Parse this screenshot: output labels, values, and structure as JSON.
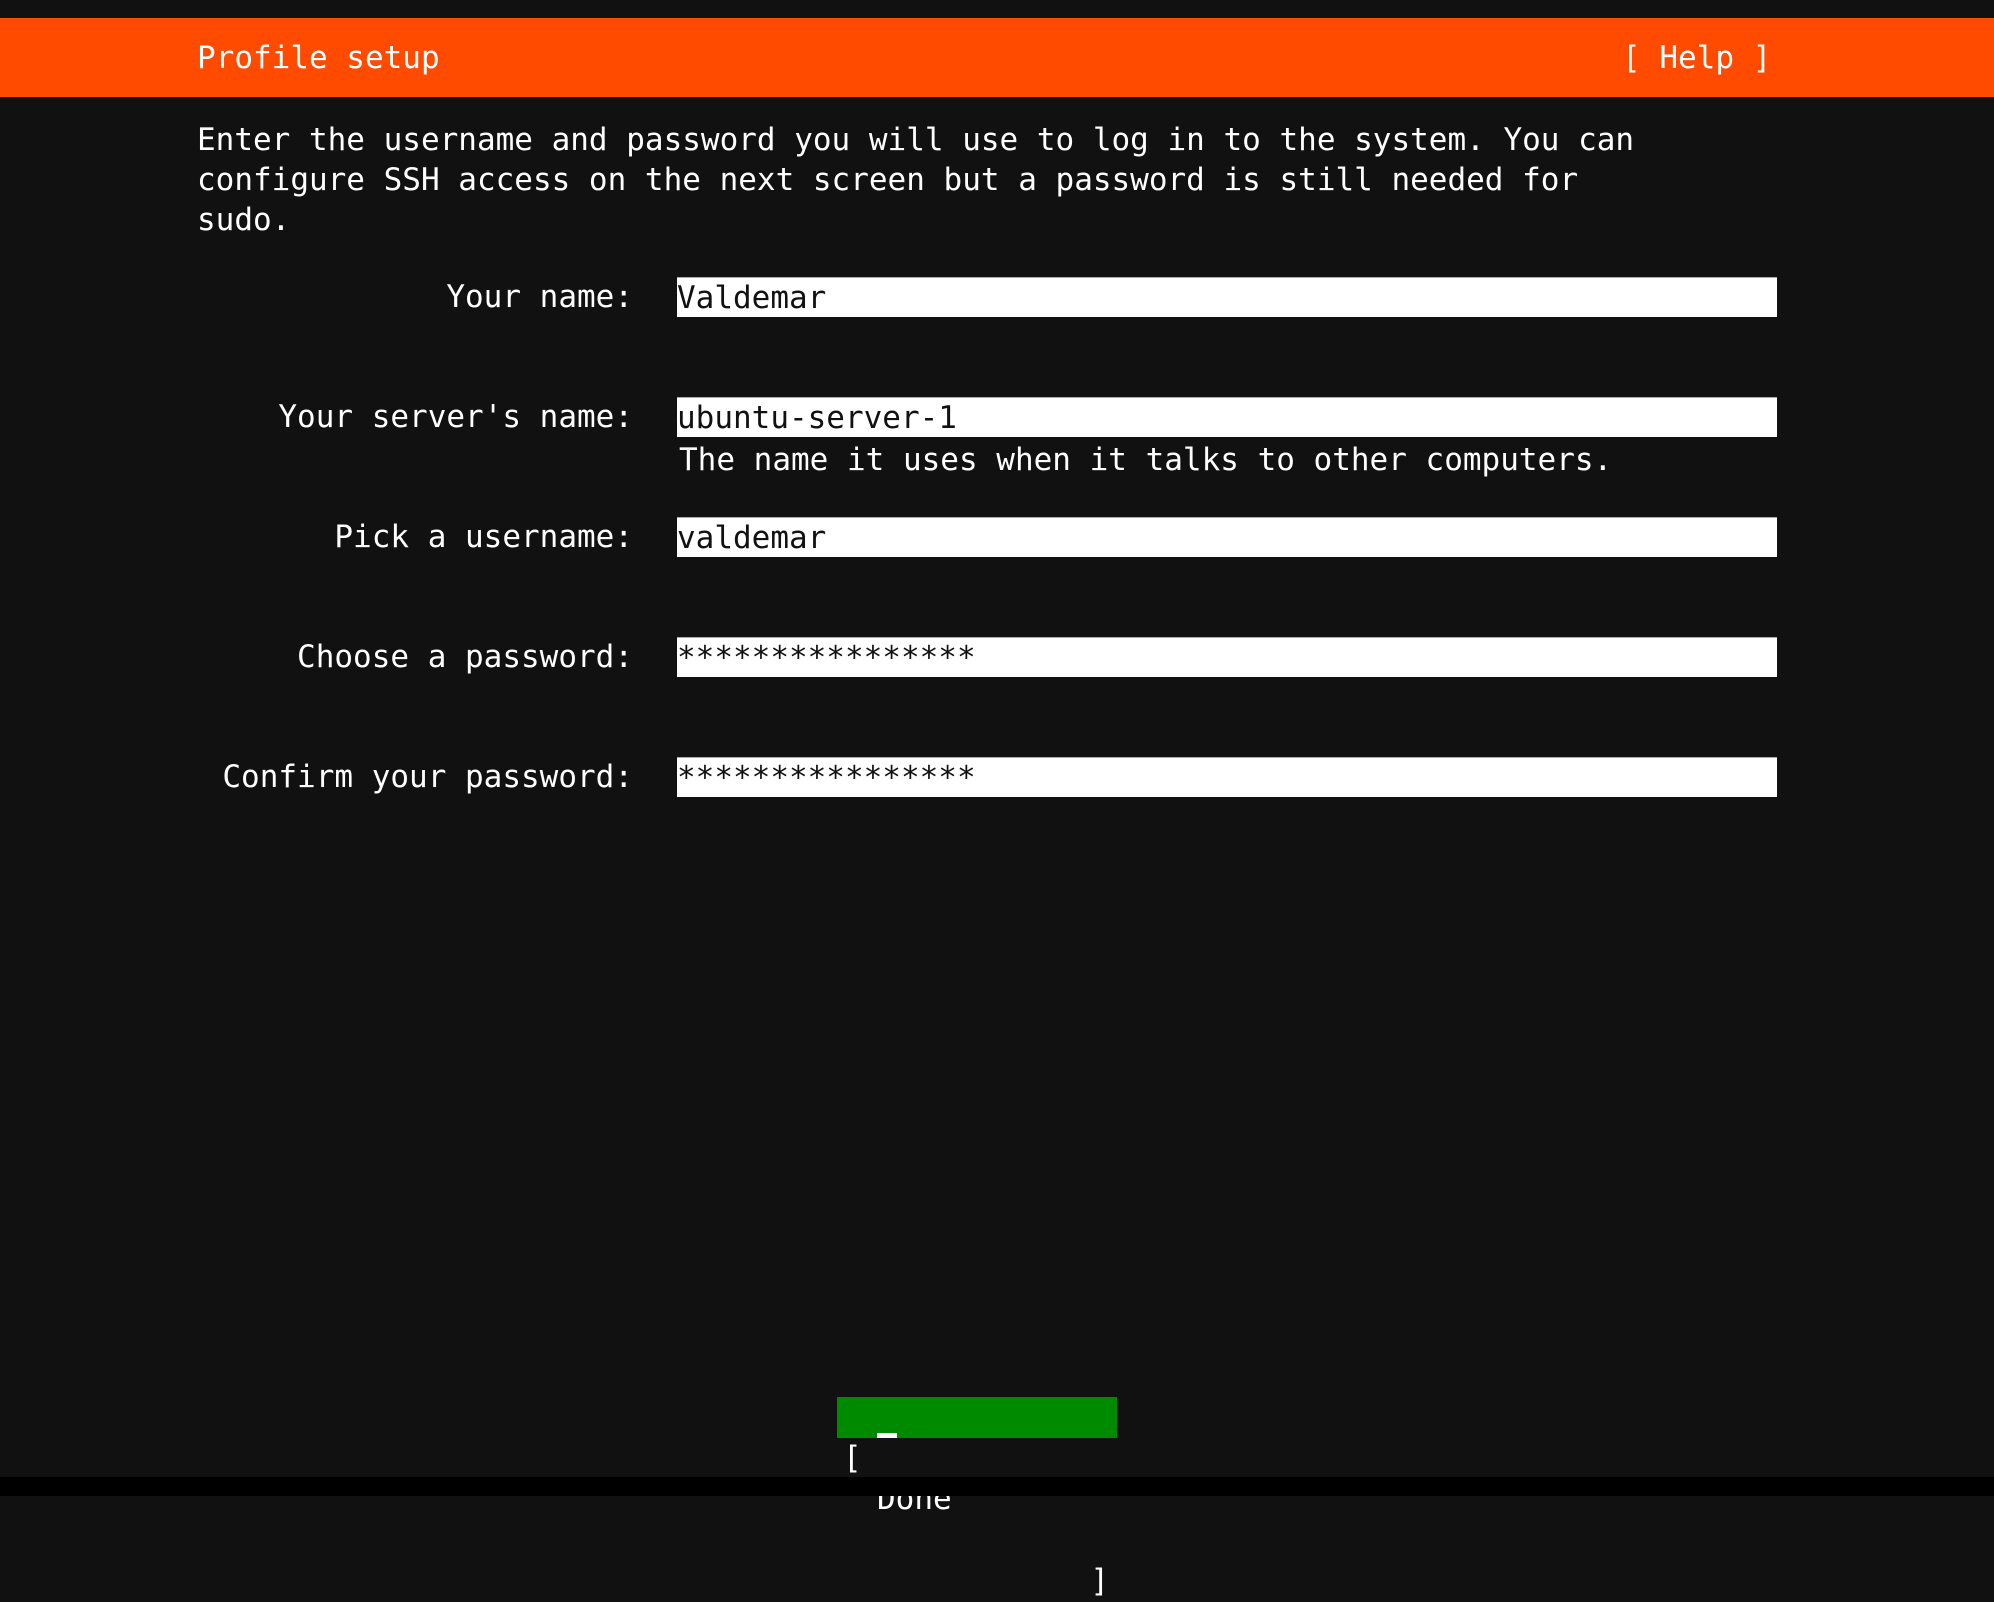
{
  "header": {
    "title": "Profile setup",
    "help_label": "[ Help ]"
  },
  "intro": "Enter the username and password you will use to log in to the system. You can\nconfigure SSH access on the next screen but a password is still needed for\nsudo.",
  "form": {
    "fields": [
      {
        "label": "Your name:",
        "value": "Valdemar"
      },
      {
        "label": "Your server's name:",
        "value": "ubuntu-server-1",
        "hint": "The name it uses when it talks to other computers."
      },
      {
        "label": "Pick a username:",
        "value": "valdemar"
      },
      {
        "label": "Choose a password:",
        "value": "****************"
      },
      {
        "label": "Confirm your password:",
        "value": "****************"
      }
    ]
  },
  "actions": {
    "done_open": "[",
    "done_label": "Done",
    "done_close": "]"
  },
  "colors": {
    "header_bg": "#fe4b00",
    "done_bg": "#008a00",
    "background": "#111111"
  }
}
